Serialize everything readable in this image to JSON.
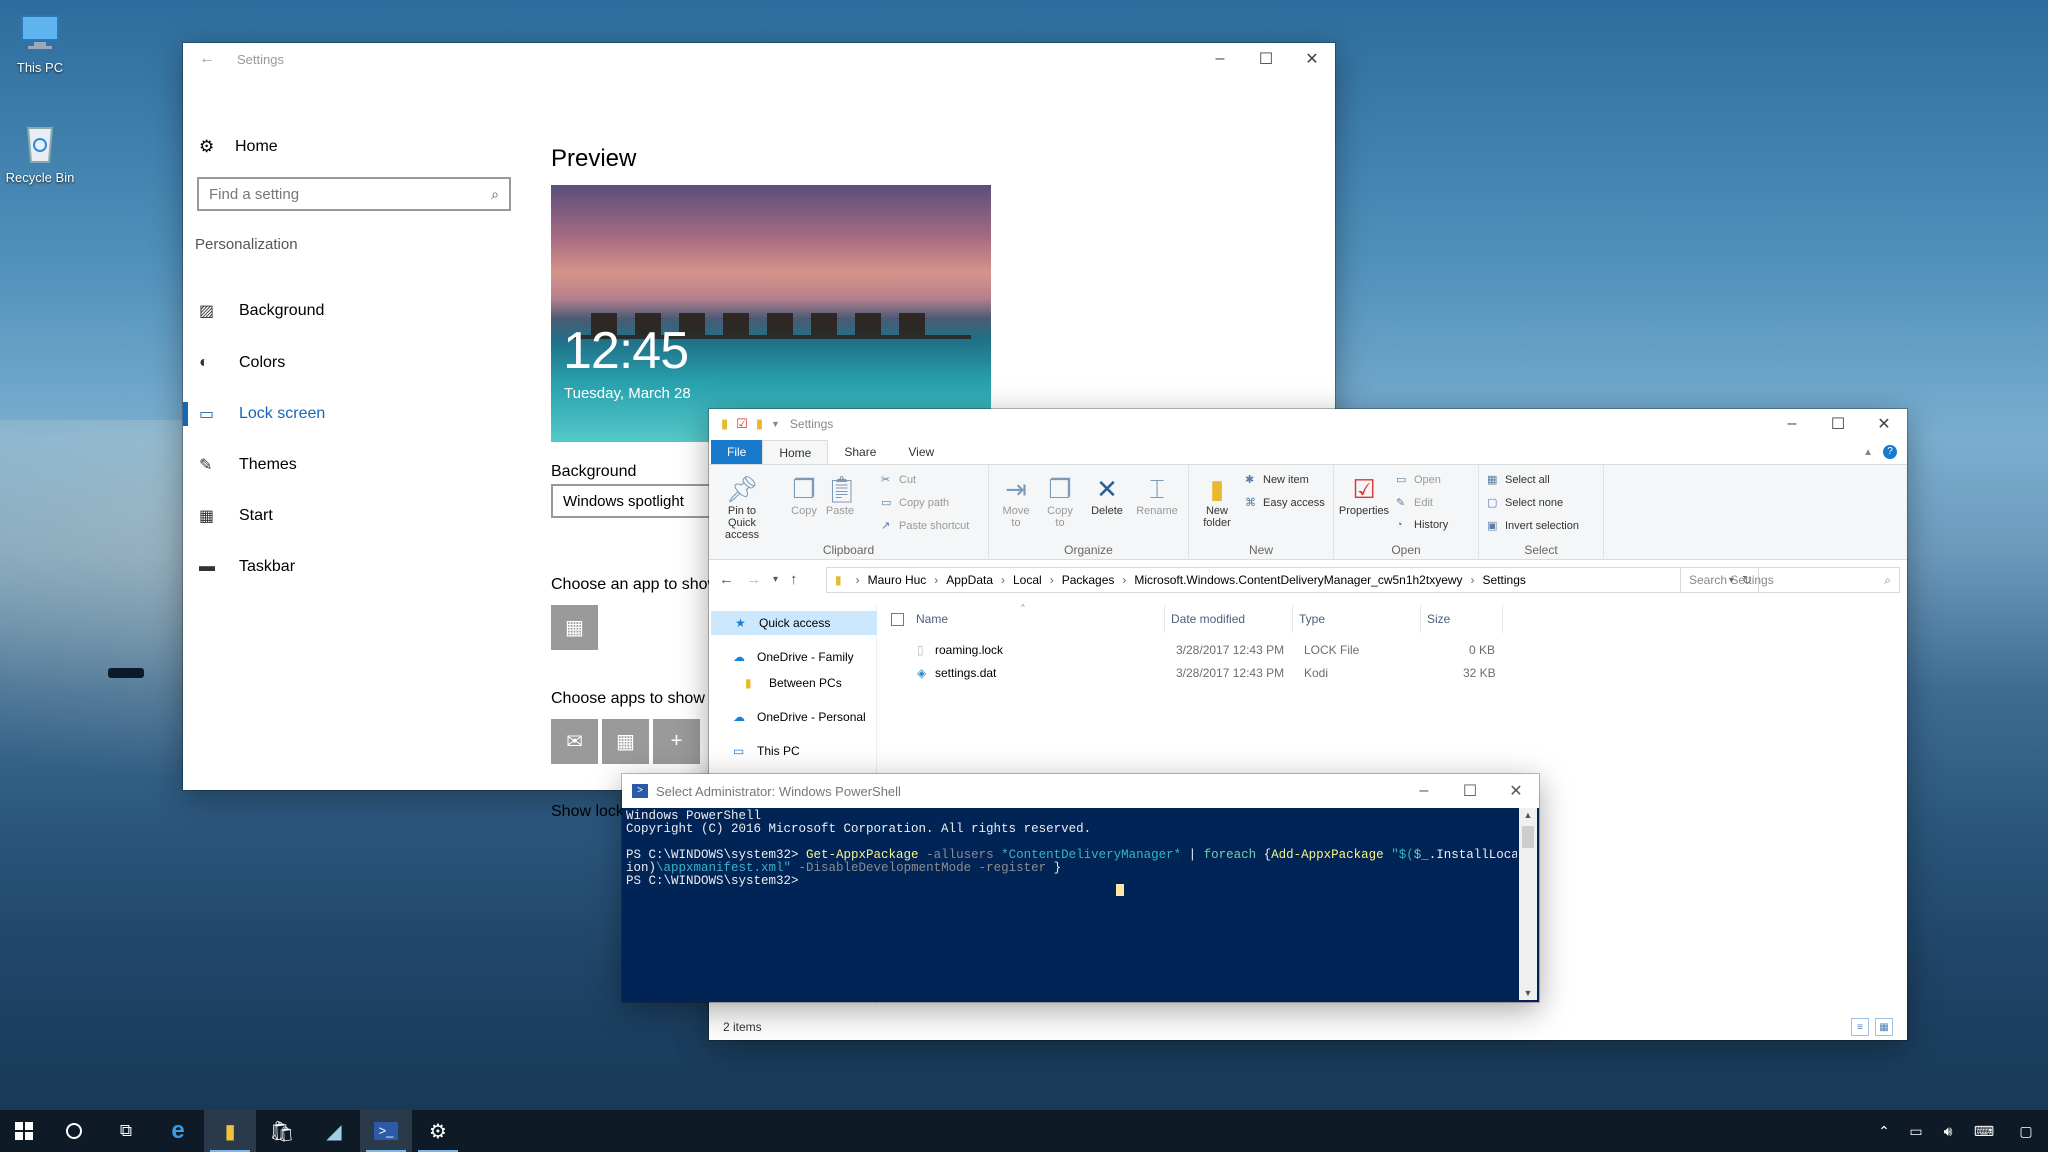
{
  "desktop": {
    "icons": [
      {
        "label": "This PC"
      },
      {
        "label": "Recycle Bin"
      }
    ]
  },
  "settings": {
    "window_title": "Settings",
    "home_label": "Home",
    "search_placeholder": "Find a setting",
    "section_label": "Personalization",
    "nav_items": [
      {
        "label": "Background",
        "icon": "image-icon"
      },
      {
        "label": "Colors",
        "icon": "palette-icon"
      },
      {
        "label": "Lock screen",
        "icon": "lock-screen-icon",
        "active": true
      },
      {
        "label": "Themes",
        "icon": "brush-icon"
      },
      {
        "label": "Start",
        "icon": "start-icon"
      },
      {
        "label": "Taskbar",
        "icon": "taskbar-icon"
      }
    ],
    "preview_title": "Preview",
    "preview_time": "12:45",
    "preview_date": "Tuesday, March 28",
    "background_label": "Background",
    "background_value": "Windows spotlight",
    "choose_detail_label": "Choose an app to show detailed status",
    "choose_quick_label": "Choose apps to show quick status",
    "show_background_label": "Show lock screen background picture on the sign-in screen",
    "accent_color": "#1466b8"
  },
  "explorer": {
    "window_title": "Settings",
    "tabs": [
      "File",
      "Home",
      "Share",
      "View"
    ],
    "ribbon": {
      "clipboard": {
        "label": "Clipboard",
        "pin": "Pin to Quick access",
        "copy": "Copy",
        "paste": "Paste",
        "cut": "Cut",
        "copy_path": "Copy path",
        "paste_shortcut": "Paste shortcut"
      },
      "organize": {
        "label": "Organize",
        "move_to": "Move to",
        "copy_to": "Copy to",
        "delete": "Delete",
        "rename": "Rename"
      },
      "new": {
        "label": "New",
        "new_folder": "New folder",
        "new_item": "New item",
        "easy_access": "Easy access"
      },
      "open": {
        "label": "Open",
        "properties": "Properties",
        "open": "Open",
        "edit": "Edit",
        "history": "History"
      },
      "select": {
        "label": "Select",
        "select_all": "Select all",
        "select_none": "Select none",
        "invert": "Invert selection"
      }
    },
    "breadcrumb": [
      "Mauro Huc",
      "AppData",
      "Local",
      "Packages",
      "Microsoft.Windows.ContentDeliveryManager_cw5n1h2txyewy",
      "Settings"
    ],
    "search_placeholder": "Search Settings",
    "nav_pane": [
      {
        "label": "Quick access",
        "selected": true
      },
      {
        "label": "OneDrive - Family"
      },
      {
        "label": "Between PCs"
      },
      {
        "label": "OneDrive - Personal"
      },
      {
        "label": "This PC"
      }
    ],
    "columns": [
      "Name",
      "Date modified",
      "Type",
      "Size"
    ],
    "files": [
      {
        "name": "roaming.lock",
        "date": "3/28/2017 12:43 PM",
        "type": "LOCK File",
        "size": "0 KB"
      },
      {
        "name": "settings.dat",
        "date": "3/28/2017 12:43 PM",
        "type": "Kodi",
        "size": "32 KB"
      }
    ],
    "status": "2 items"
  },
  "powershell": {
    "window_title": "Select Administrator: Windows PowerShell",
    "line1": "Windows PowerShell",
    "line2": "Copyright (C) 2016 Microsoft Corporation. All rights reserved.",
    "prompt": "PS C:\\WINDOWS\\system32> ",
    "cmd_get": "Get-AppxPackage",
    "cmd_allusers": " -allusers ",
    "cmd_string": "*ContentDeliveryManager*",
    "cmd_pipe": " | ",
    "cmd_foreach": "foreach",
    "cmd_brace": " {",
    "cmd_add": "Add-AppxPackage",
    "cmd_path_start": " \"$(",
    "cmd_var": "$_",
    "cmd_install": ".InstallLocat",
    "cmd_cont1": "ion)",
    "cmd_manifest": "\\appxmanifest.xml\"",
    "cmd_flags": " -DisableDevelopmentMode -register",
    "cmd_close": " }",
    "prompt2": "PS C:\\WINDOWS\\system32>",
    "bg_color": "#012456"
  },
  "taskbar": {
    "items": [
      "start-icon",
      "cortana-icon",
      "task-view-icon",
      "edge-icon",
      "file-explorer-icon",
      "store-icon",
      "app-icon",
      "powershell-icon",
      "settings-icon"
    ]
  }
}
